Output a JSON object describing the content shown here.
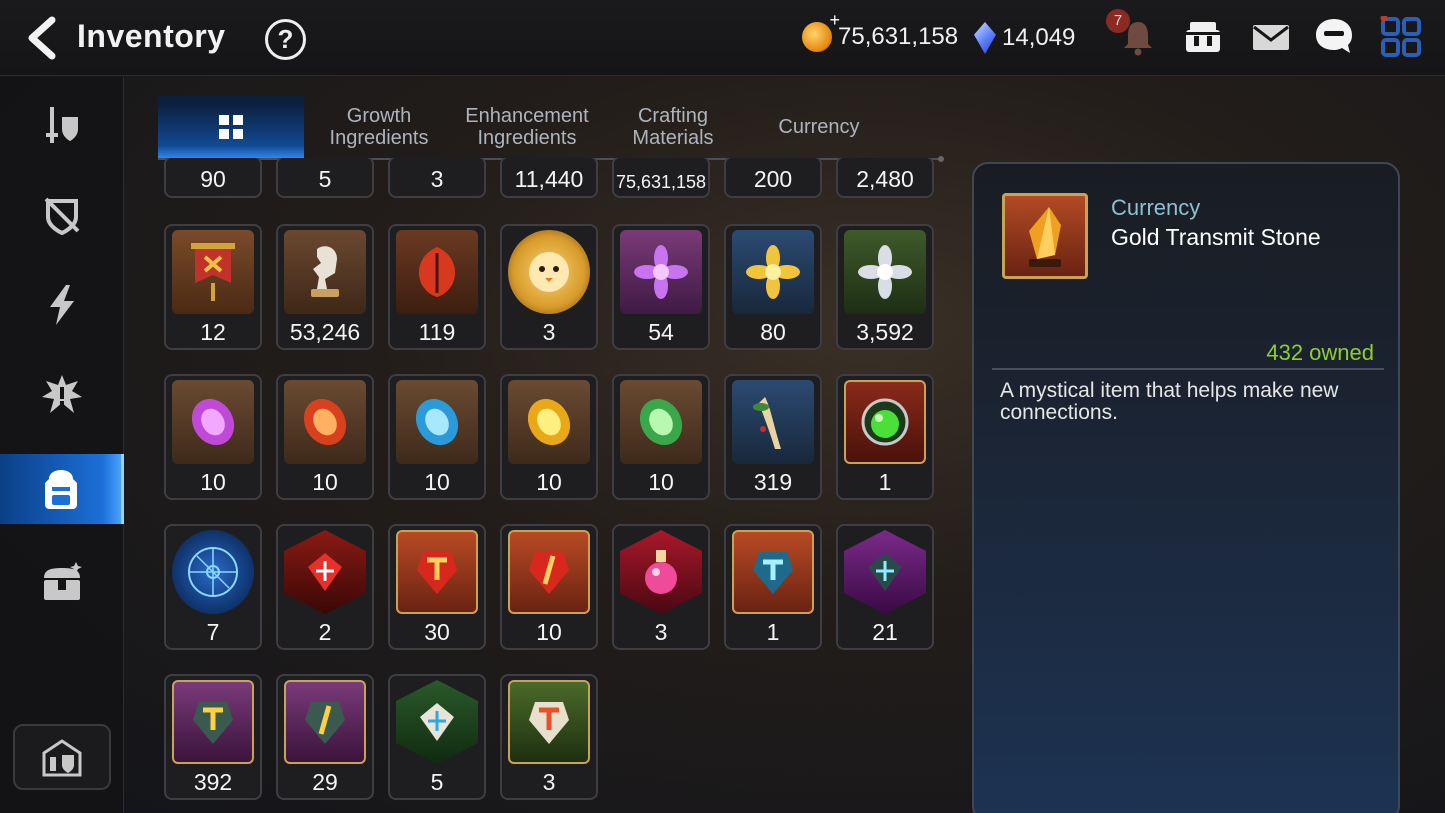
{
  "header": {
    "title": "Inventory",
    "help_label": "?",
    "gold": "75,631,158",
    "crystals": "14,049",
    "notification_count": "7",
    "icons": [
      "back-arrow-icon",
      "help-icon",
      "gold-coin-icon",
      "crystal-icon",
      "bell-icon",
      "shop-icon",
      "mail-icon",
      "chat-icon",
      "menu-grid-icon"
    ]
  },
  "sidebar": {
    "items": [
      {
        "icon": "equipment-icon",
        "active": false
      },
      {
        "icon": "artifact-icon",
        "active": false
      },
      {
        "icon": "catalyst-icon",
        "active": false
      },
      {
        "icon": "memory-imprint-icon",
        "active": false
      },
      {
        "icon": "backpack-icon",
        "active": true
      },
      {
        "icon": "treasure-chest-icon",
        "active": false
      }
    ],
    "guild_icon": "guild-house-icon"
  },
  "tabs": [
    {
      "label": "",
      "icon": "grid-view-icon",
      "active": true
    },
    {
      "label": "Growth\nIngredients",
      "active": false
    },
    {
      "label": "Enhancement\nIngredients",
      "active": false
    },
    {
      "label": "Crafting\nMaterials",
      "active": false
    },
    {
      "label": "Currency",
      "active": false
    }
  ],
  "items": [
    [
      {
        "count": "90"
      },
      {
        "count": "5"
      },
      {
        "count": "3"
      },
      {
        "count": "11,440"
      },
      {
        "count": "75,631,158"
      },
      {
        "count": "200"
      },
      {
        "count": "2,480"
      }
    ],
    [
      {
        "count": "12",
        "icon": "banner-icon"
      },
      {
        "count": "53,246",
        "icon": "horse-statue-icon"
      },
      {
        "count": "119",
        "icon": "red-leaf-icon"
      },
      {
        "count": "3",
        "icon": "mascot-icon"
      },
      {
        "count": "54",
        "icon": "purple-flower-icon"
      },
      {
        "count": "80",
        "icon": "gold-flower-icon"
      },
      {
        "count": "3,592",
        "icon": "silver-flower-icon"
      }
    ],
    [
      {
        "count": "10",
        "icon": "purple-rune-icon"
      },
      {
        "count": "10",
        "icon": "red-rune-icon"
      },
      {
        "count": "10",
        "icon": "blue-rune-icon"
      },
      {
        "count": "10",
        "icon": "gold-rune-icon"
      },
      {
        "count": "10",
        "icon": "green-rune-icon"
      },
      {
        "count": "319",
        "icon": "ginseng-icon"
      },
      {
        "count": "1",
        "icon": "green-orb-icon"
      }
    ],
    [
      {
        "count": "7",
        "icon": "blue-sigil-icon"
      },
      {
        "count": "2",
        "icon": "red-gem-hex-icon"
      },
      {
        "count": "30",
        "icon": "red-hammer-stone-icon"
      },
      {
        "count": "10",
        "icon": "red-bar-stone-icon"
      },
      {
        "count": "3",
        "icon": "potion-icon"
      },
      {
        "count": "1",
        "icon": "blue-hammer-stone-icon"
      },
      {
        "count": "21",
        "icon": "purple-gem-hex-icon"
      }
    ],
    [
      {
        "count": "392",
        "icon": "purple-hammer-stone-icon"
      },
      {
        "count": "29",
        "icon": "purple-bar-stone-icon"
      },
      {
        "count": "5",
        "icon": "white-gem-hex-icon"
      },
      {
        "count": "3",
        "icon": "green-hammer-stone-icon"
      }
    ]
  ],
  "detail": {
    "category": "Currency",
    "name": "Gold Transmit Stone",
    "owned": "432 owned",
    "description": "A mystical item that helps make new connections.",
    "icon": "gold-transmit-stone-icon"
  },
  "colors": {
    "accent_blue": "#1c6fd8",
    "owned_green": "#8fce2f",
    "category_teal": "#8fc0d0"
  }
}
